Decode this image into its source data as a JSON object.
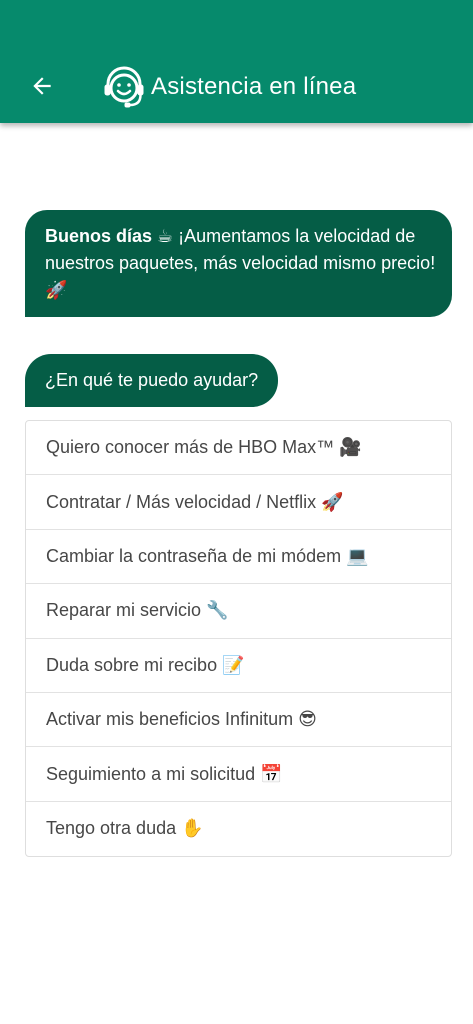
{
  "header": {
    "title": "Asistencia en línea",
    "back_icon": "arrow-left-icon",
    "title_icon": "headset-agent-icon",
    "background_color": "#068a6c"
  },
  "greeting": {
    "bold_text": "Buenos días",
    "message": " ☕ ¡Aumentamos la velocidad de nuestros paquetes, más velocidad mismo precio! 🚀",
    "bubble_color": "#055d46"
  },
  "question": {
    "text": "¿En qué te puedo ayudar?"
  },
  "options": [
    {
      "label": "Quiero conocer más de HBO Max™ 🎥"
    },
    {
      "label": "Contratar / Más velocidad / Netflix 🚀"
    },
    {
      "label": "Cambiar la contraseña de mi módem 💻"
    },
    {
      "label": "Reparar mi servicio 🔧"
    },
    {
      "label": "Duda sobre mi recibo 📝"
    },
    {
      "label": "Activar mis beneficios Infinitum 😎"
    },
    {
      "label": "Seguimiento a mi solicitud 📅"
    },
    {
      "label": "Tengo otra duda ✋"
    }
  ]
}
